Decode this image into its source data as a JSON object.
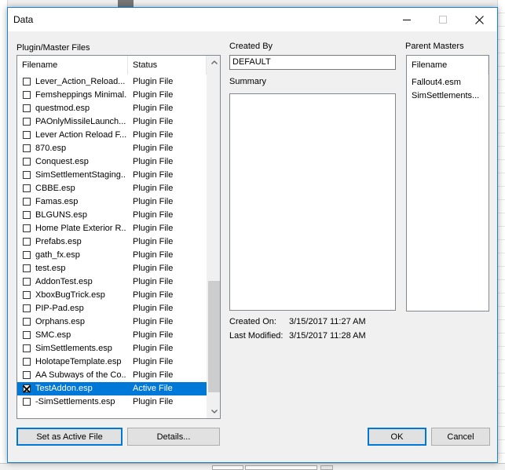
{
  "window": {
    "title": "Data"
  },
  "plugin_files": {
    "group_label": "Plugin/Master Files",
    "columns": {
      "filename": "Filename",
      "status": "Status"
    },
    "rows": [
      {
        "name": "Lever_Action_Reload...",
        "status": "Plugin File",
        "checked": false,
        "selected": false
      },
      {
        "name": "Femsheppings Minimal...",
        "status": "Plugin File",
        "checked": false,
        "selected": false
      },
      {
        "name": "questmod.esp",
        "status": "Plugin File",
        "checked": false,
        "selected": false
      },
      {
        "name": "PAOnlyMissileLaunch...",
        "status": "Plugin File",
        "checked": false,
        "selected": false
      },
      {
        "name": "Lever Action Reload F...",
        "status": "Plugin File",
        "checked": false,
        "selected": false
      },
      {
        "name": "870.esp",
        "status": "Plugin File",
        "checked": false,
        "selected": false
      },
      {
        "name": "Conquest.esp",
        "status": "Plugin File",
        "checked": false,
        "selected": false
      },
      {
        "name": "SimSettlementStaging....",
        "status": "Plugin File",
        "checked": false,
        "selected": false
      },
      {
        "name": "CBBE.esp",
        "status": "Plugin File",
        "checked": false,
        "selected": false
      },
      {
        "name": "Famas.esp",
        "status": "Plugin File",
        "checked": false,
        "selected": false
      },
      {
        "name": "BLGUNS.esp",
        "status": "Plugin File",
        "checked": false,
        "selected": false
      },
      {
        "name": "Home Plate Exterior R...",
        "status": "Plugin File",
        "checked": false,
        "selected": false
      },
      {
        "name": "Prefabs.esp",
        "status": "Plugin File",
        "checked": false,
        "selected": false
      },
      {
        "name": "gath_fx.esp",
        "status": "Plugin File",
        "checked": false,
        "selected": false
      },
      {
        "name": "test.esp",
        "status": "Plugin File",
        "checked": false,
        "selected": false
      },
      {
        "name": "AddonTest.esp",
        "status": "Plugin File",
        "checked": false,
        "selected": false
      },
      {
        "name": "XboxBugTrick.esp",
        "status": "Plugin File",
        "checked": false,
        "selected": false
      },
      {
        "name": "PIP-Pad.esp",
        "status": "Plugin File",
        "checked": false,
        "selected": false
      },
      {
        "name": "Orphans.esp",
        "status": "Plugin File",
        "checked": false,
        "selected": false
      },
      {
        "name": "SMC.esp",
        "status": "Plugin File",
        "checked": false,
        "selected": false
      },
      {
        "name": "SimSettlements.esp",
        "status": "Plugin File",
        "checked": false,
        "selected": false
      },
      {
        "name": "HolotapeTemplate.esp",
        "status": "Plugin File",
        "checked": false,
        "selected": false
      },
      {
        "name": "AA Subways of the Co...",
        "status": "Plugin File",
        "checked": false,
        "selected": false
      },
      {
        "name": "TestAddon.esp",
        "status": "Active File",
        "checked": true,
        "selected": true
      },
      {
        "name": "-SimSettlements.esp",
        "status": "Plugin File",
        "checked": false,
        "selected": false
      }
    ]
  },
  "created_by": {
    "label": "Created By",
    "value": "DEFAULT"
  },
  "summary": {
    "label": "Summary",
    "value": ""
  },
  "created_on": {
    "label": "Created On:",
    "value": "3/15/2017  11:27 AM"
  },
  "last_modified": {
    "label": "Last Modified:",
    "value": "3/15/2017  11:28 AM"
  },
  "parent_masters": {
    "group_label": "Parent Masters",
    "column": "Filename",
    "rows": [
      "Fallout4.esm",
      "SimSettlements..."
    ]
  },
  "buttons": {
    "set_active": "Set as Active File",
    "details": "Details...",
    "ok": "OK",
    "cancel": "Cancel"
  },
  "icons": {
    "minimize": "minimize-icon",
    "maximize": "maximize-icon",
    "close": "close-icon",
    "scroll_up": "chevron-up-icon",
    "scroll_down": "chevron-down-icon"
  },
  "colors": {
    "selection": "#0078d7",
    "window_border": "#1883d7"
  }
}
